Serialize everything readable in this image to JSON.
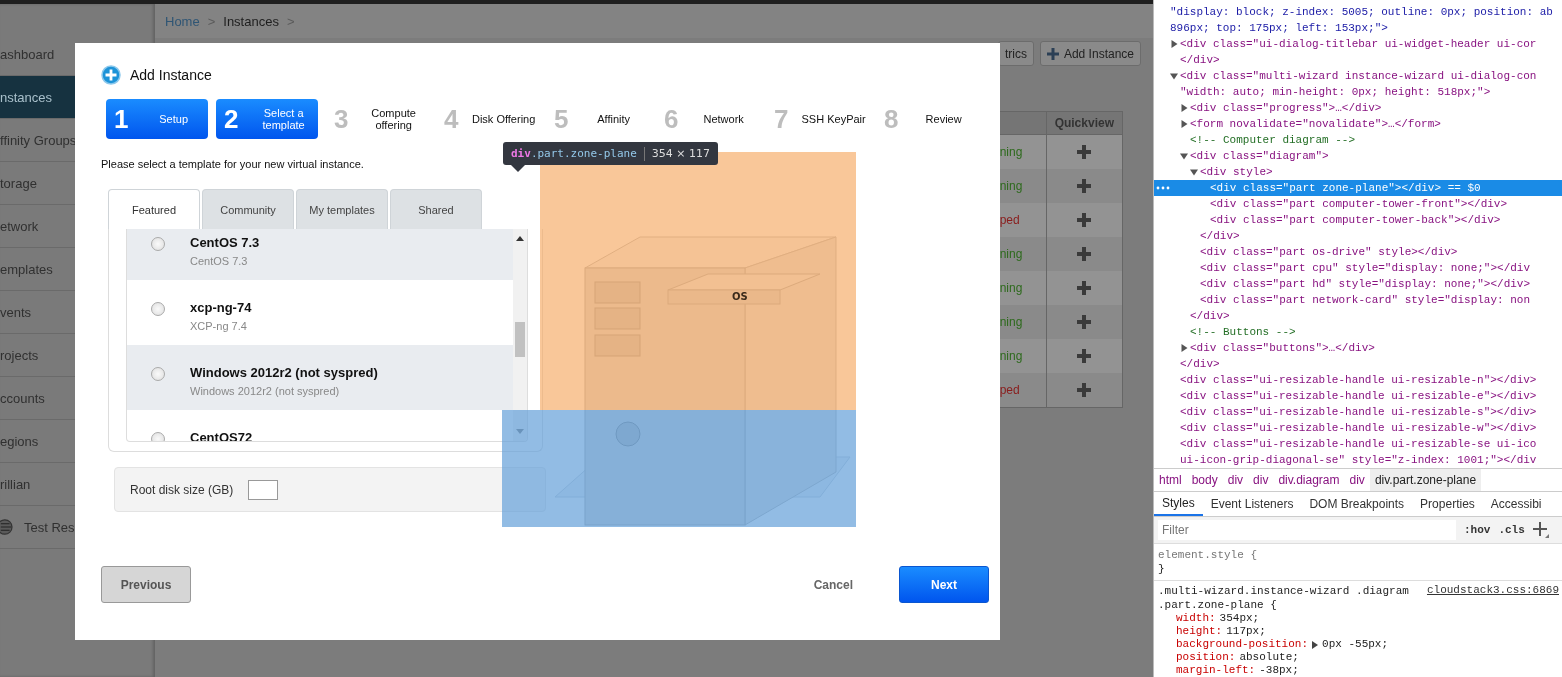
{
  "app": {
    "sidebar": [
      {
        "label": "ashboard",
        "selected": false,
        "kind": "text"
      },
      {
        "label": "nstances",
        "selected": true,
        "kind": "text"
      },
      {
        "label": "ffinity Groups",
        "selected": false,
        "kind": "text"
      },
      {
        "label": "torage",
        "selected": false,
        "kind": "text"
      },
      {
        "label": "etwork",
        "selected": false,
        "kind": "text"
      },
      {
        "label": "emplates",
        "selected": false,
        "kind": "text"
      },
      {
        "label": "vents",
        "selected": false,
        "kind": "text"
      },
      {
        "label": "rojects",
        "selected": false,
        "kind": "text"
      },
      {
        "label": "ccounts",
        "selected": false,
        "kind": "text"
      },
      {
        "label": "egions",
        "selected": false,
        "kind": "text"
      },
      {
        "label": "rillian",
        "selected": false,
        "kind": "text"
      },
      {
        "label": "Test Res",
        "selected": false,
        "kind": "icon"
      }
    ],
    "breadcrumb": [
      {
        "label": "Home",
        "kind": "link"
      },
      {
        "label": ">",
        "kind": "separator"
      },
      {
        "label": "Instances",
        "kind": "current"
      },
      {
        "label": ">",
        "kind": "separator"
      }
    ],
    "toolbar": [
      {
        "label": "trics",
        "kind": "plain"
      },
      {
        "label": "Add Instance",
        "kind": "add"
      }
    ],
    "table": {
      "columns": [
        {
          "label": "Quickview"
        }
      ],
      "rows": [
        {
          "state": "ning",
          "color": "#2d6a1c"
        },
        {
          "state": "ning",
          "color": "#2d6a1c"
        },
        {
          "state": "ped",
          "color": "#8a1c1c"
        },
        {
          "state": "ning",
          "color": "#2d6a1c"
        },
        {
          "state": "ning",
          "color": "#2d6a1c"
        },
        {
          "state": "ning",
          "color": "#2d6a1c"
        },
        {
          "state": "ning",
          "color": "#2d6a1c"
        },
        {
          "state": "ped",
          "color": "#8a1c1c"
        }
      ]
    }
  },
  "modal": {
    "title": "Add Instance",
    "steps": [
      {
        "number": "1",
        "label": "Setup",
        "selected": true
      },
      {
        "number": "2",
        "label": "Select a template",
        "selected": true
      },
      {
        "number": "3",
        "label": "Compute offering",
        "selected": false
      },
      {
        "number": "4",
        "label": "Disk Offering",
        "selected": false
      },
      {
        "number": "5",
        "label": "Affinity",
        "selected": false
      },
      {
        "number": "6",
        "label": "Network",
        "selected": false
      },
      {
        "number": "7",
        "label": "SSH KeyPair",
        "selected": false
      },
      {
        "number": "8",
        "label": "Review",
        "selected": false
      }
    ],
    "intro": "Please select a template for your new virtual instance.",
    "tabs": [
      {
        "label": "Featured",
        "selected": true
      },
      {
        "label": "Community",
        "selected": false
      },
      {
        "label": "My templates",
        "selected": false
      },
      {
        "label": "Shared",
        "selected": false
      }
    ],
    "templates": [
      {
        "name": "CentOS 7.3",
        "description": "CentOS 7.3",
        "selected": false
      },
      {
        "name": "xcp-ng-74",
        "description": "XCP-ng 7.4",
        "selected": false
      },
      {
        "name": "Windows 2012r2 (not syspred)",
        "description": "Windows 2012r2 (not syspred)",
        "selected": false
      },
      {
        "name": "CentOS72",
        "selected": false
      }
    ],
    "root_disk": {
      "label": "Root disk size (GB)"
    },
    "diagram": {
      "drive_label": "OS"
    },
    "inspector_tooltip": {
      "tag": "div",
      "classes": ".part.zone-plane",
      "size": "354 × 117"
    },
    "buttons": [
      {
        "label": "Previous",
        "kind": "previous"
      },
      {
        "label": "Cancel",
        "kind": "cancel"
      },
      {
        "label": "Next",
        "kind": "next"
      }
    ]
  },
  "devtools": {
    "dom_tree": [
      {
        "kind": "attr",
        "lines": [
          "\"display: block; z-index: 5005; outline: 0px; position: ab",
          "896px; top: 175px; left: 153px;\">"
        ],
        "children": [
          {
            "kind": "tag",
            "lines": [
              "<div class=\"ui-dialog-titlebar ui-widget-header ui-cor"
            ],
            "expanded": false
          },
          {
            "kind": "tag",
            "lines": [
              "</div>"
            ]
          },
          {
            "kind": "tag",
            "lines": [
              "<div class=\"multi-wizard instance-wizard ui-dialog-con",
              "\"width: auto; min-height: 0px; height: 518px;\">"
            ],
            "expanded": true,
            "children": [
              {
                "kind": "tag",
                "lines": [
                  "<div class=\"progress\">…</div>"
                ],
                "expanded": false
              },
              {
                "kind": "tag",
                "lines": [
                  "<form novalidate=\"novalidate\">…</form>"
                ],
                "expanded": false
              },
              {
                "kind": "comment",
                "lines": [
                  "<!-- Computer diagram -->"
                ]
              },
              {
                "kind": "tag",
                "lines": [
                  "<div class=\"diagram\">"
                ],
                "expanded": true,
                "children": [
                  {
                    "kind": "tag",
                    "lines": [
                      "<div style>"
                    ],
                    "expanded": true,
                    "children": [
                      {
                        "kind": "tag",
                        "lines": [
                          "<div class=\"part zone-plane\"></div> == $0"
                        ],
                        "selected": true
                      },
                      {
                        "kind": "tag",
                        "lines": [
                          "<div class=\"part computer-tower-front\"></div>"
                        ],
                        "selected": false
                      },
                      {
                        "kind": "tag",
                        "lines": [
                          "<div class=\"part computer-tower-back\"></div>"
                        ],
                        "selected": false
                      }
                    ]
                  },
                  {
                    "kind": "tag",
                    "lines": [
                      "</div>"
                    ]
                  },
                  {
                    "kind": "tag",
                    "lines": [
                      "<div class=\"part os-drive\" style></div>"
                    ]
                  },
                  {
                    "kind": "tag",
                    "lines": [
                      "<div class=\"part cpu\" style=\"display: none;\"></div"
                    ]
                  },
                  {
                    "kind": "tag",
                    "lines": [
                      "<div class=\"part hd\" style=\"display: none;\"></div>"
                    ]
                  },
                  {
                    "kind": "tag",
                    "lines": [
                      "<div class=\"part network-card\" style=\"display: non"
                    ]
                  }
                ]
              },
              {
                "kind": "tag",
                "lines": [
                  "</div>"
                ]
              },
              {
                "kind": "comment",
                "lines": [
                  "<!-- Buttons -->"
                ]
              },
              {
                "kind": "tag",
                "lines": [
                  "<div class=\"buttons\">…</div>"
                ],
                "expanded": false
              }
            ]
          },
          {
            "kind": "tag",
            "lines": [
              "</div>"
            ]
          },
          {
            "kind": "tag",
            "lines": [
              "<div class=\"ui-resizable-handle ui-resizable-n\"></div>"
            ]
          },
          {
            "kind": "tag",
            "lines": [
              "<div class=\"ui-resizable-handle ui-resizable-e\"></div>"
            ]
          },
          {
            "kind": "tag",
            "lines": [
              "<div class=\"ui-resizable-handle ui-resizable-s\"></div>"
            ]
          },
          {
            "kind": "tag",
            "lines": [
              "<div class=\"ui-resizable-handle ui-resizable-w\"></div>"
            ]
          },
          {
            "kind": "tag",
            "lines": [
              "<div class=\"ui-resizable-handle ui-resizable-se ui-ico",
              "ui-icon-grip-diagonal-se\" style=\"z-index: 1001;\"></div"
            ]
          }
        ]
      }
    ],
    "breadcrumbs": [
      {
        "label": "html",
        "selected": false
      },
      {
        "label": "body",
        "selected": false
      },
      {
        "label": "div",
        "selected": false
      },
      {
        "label": "div",
        "selected": false
      },
      {
        "label": "div.diagram",
        "selected": false
      },
      {
        "label": "div",
        "selected": false
      },
      {
        "label": "div.part.zone-plane",
        "selected": true
      }
    ],
    "panel_tabs": [
      {
        "label": "Styles",
        "selected": true
      },
      {
        "label": "Event Listeners",
        "selected": false
      },
      {
        "label": "DOM Breakpoints",
        "selected": false
      },
      {
        "label": "Properties",
        "selected": false
      },
      {
        "label": "Accessibi",
        "selected": false
      }
    ],
    "filter": {
      "placeholder": "Filter"
    },
    "filter_buttons": [
      ":hov",
      ".cls"
    ],
    "inline_rule": {
      "selector": "element.style {",
      "close": "}"
    },
    "rule": {
      "selector": [
        ".multi-wizard.instance-wizard .diagram",
        ".part.zone-plane {"
      ],
      "source": "cloudstack3.css:6869",
      "declarations": [
        {
          "property": "width:",
          "value": "354px;",
          "expandable": false
        },
        {
          "property": "height:",
          "value": "117px;",
          "expandable": false
        },
        {
          "property": "background-position:",
          "value": "0px -55px;",
          "expandable": true
        },
        {
          "property": "position:",
          "value": "absolute;",
          "expandable": false
        },
        {
          "property": "margin-left:",
          "value": "-38px;",
          "expandable": false
        }
      ]
    }
  }
}
